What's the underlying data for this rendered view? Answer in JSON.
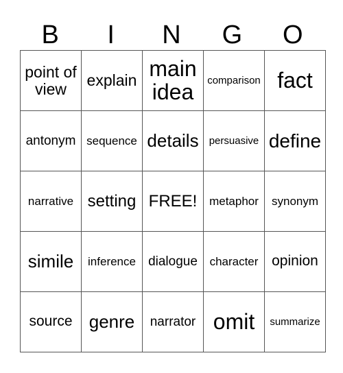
{
  "header": [
    "B",
    "I",
    "N",
    "G",
    "O"
  ],
  "rows": [
    [
      "point of view",
      "explain",
      "main idea",
      "comparison",
      "fact"
    ],
    [
      "antonym",
      "sequence",
      "details",
      "persuasive",
      "define"
    ],
    [
      "narrative",
      "setting",
      "FREE!",
      "metaphor",
      "synonym"
    ],
    [
      "simile",
      "inference",
      "dialogue",
      "character",
      "opinion"
    ],
    [
      "source",
      "genre",
      "narrator",
      "omit",
      "summarize"
    ]
  ]
}
